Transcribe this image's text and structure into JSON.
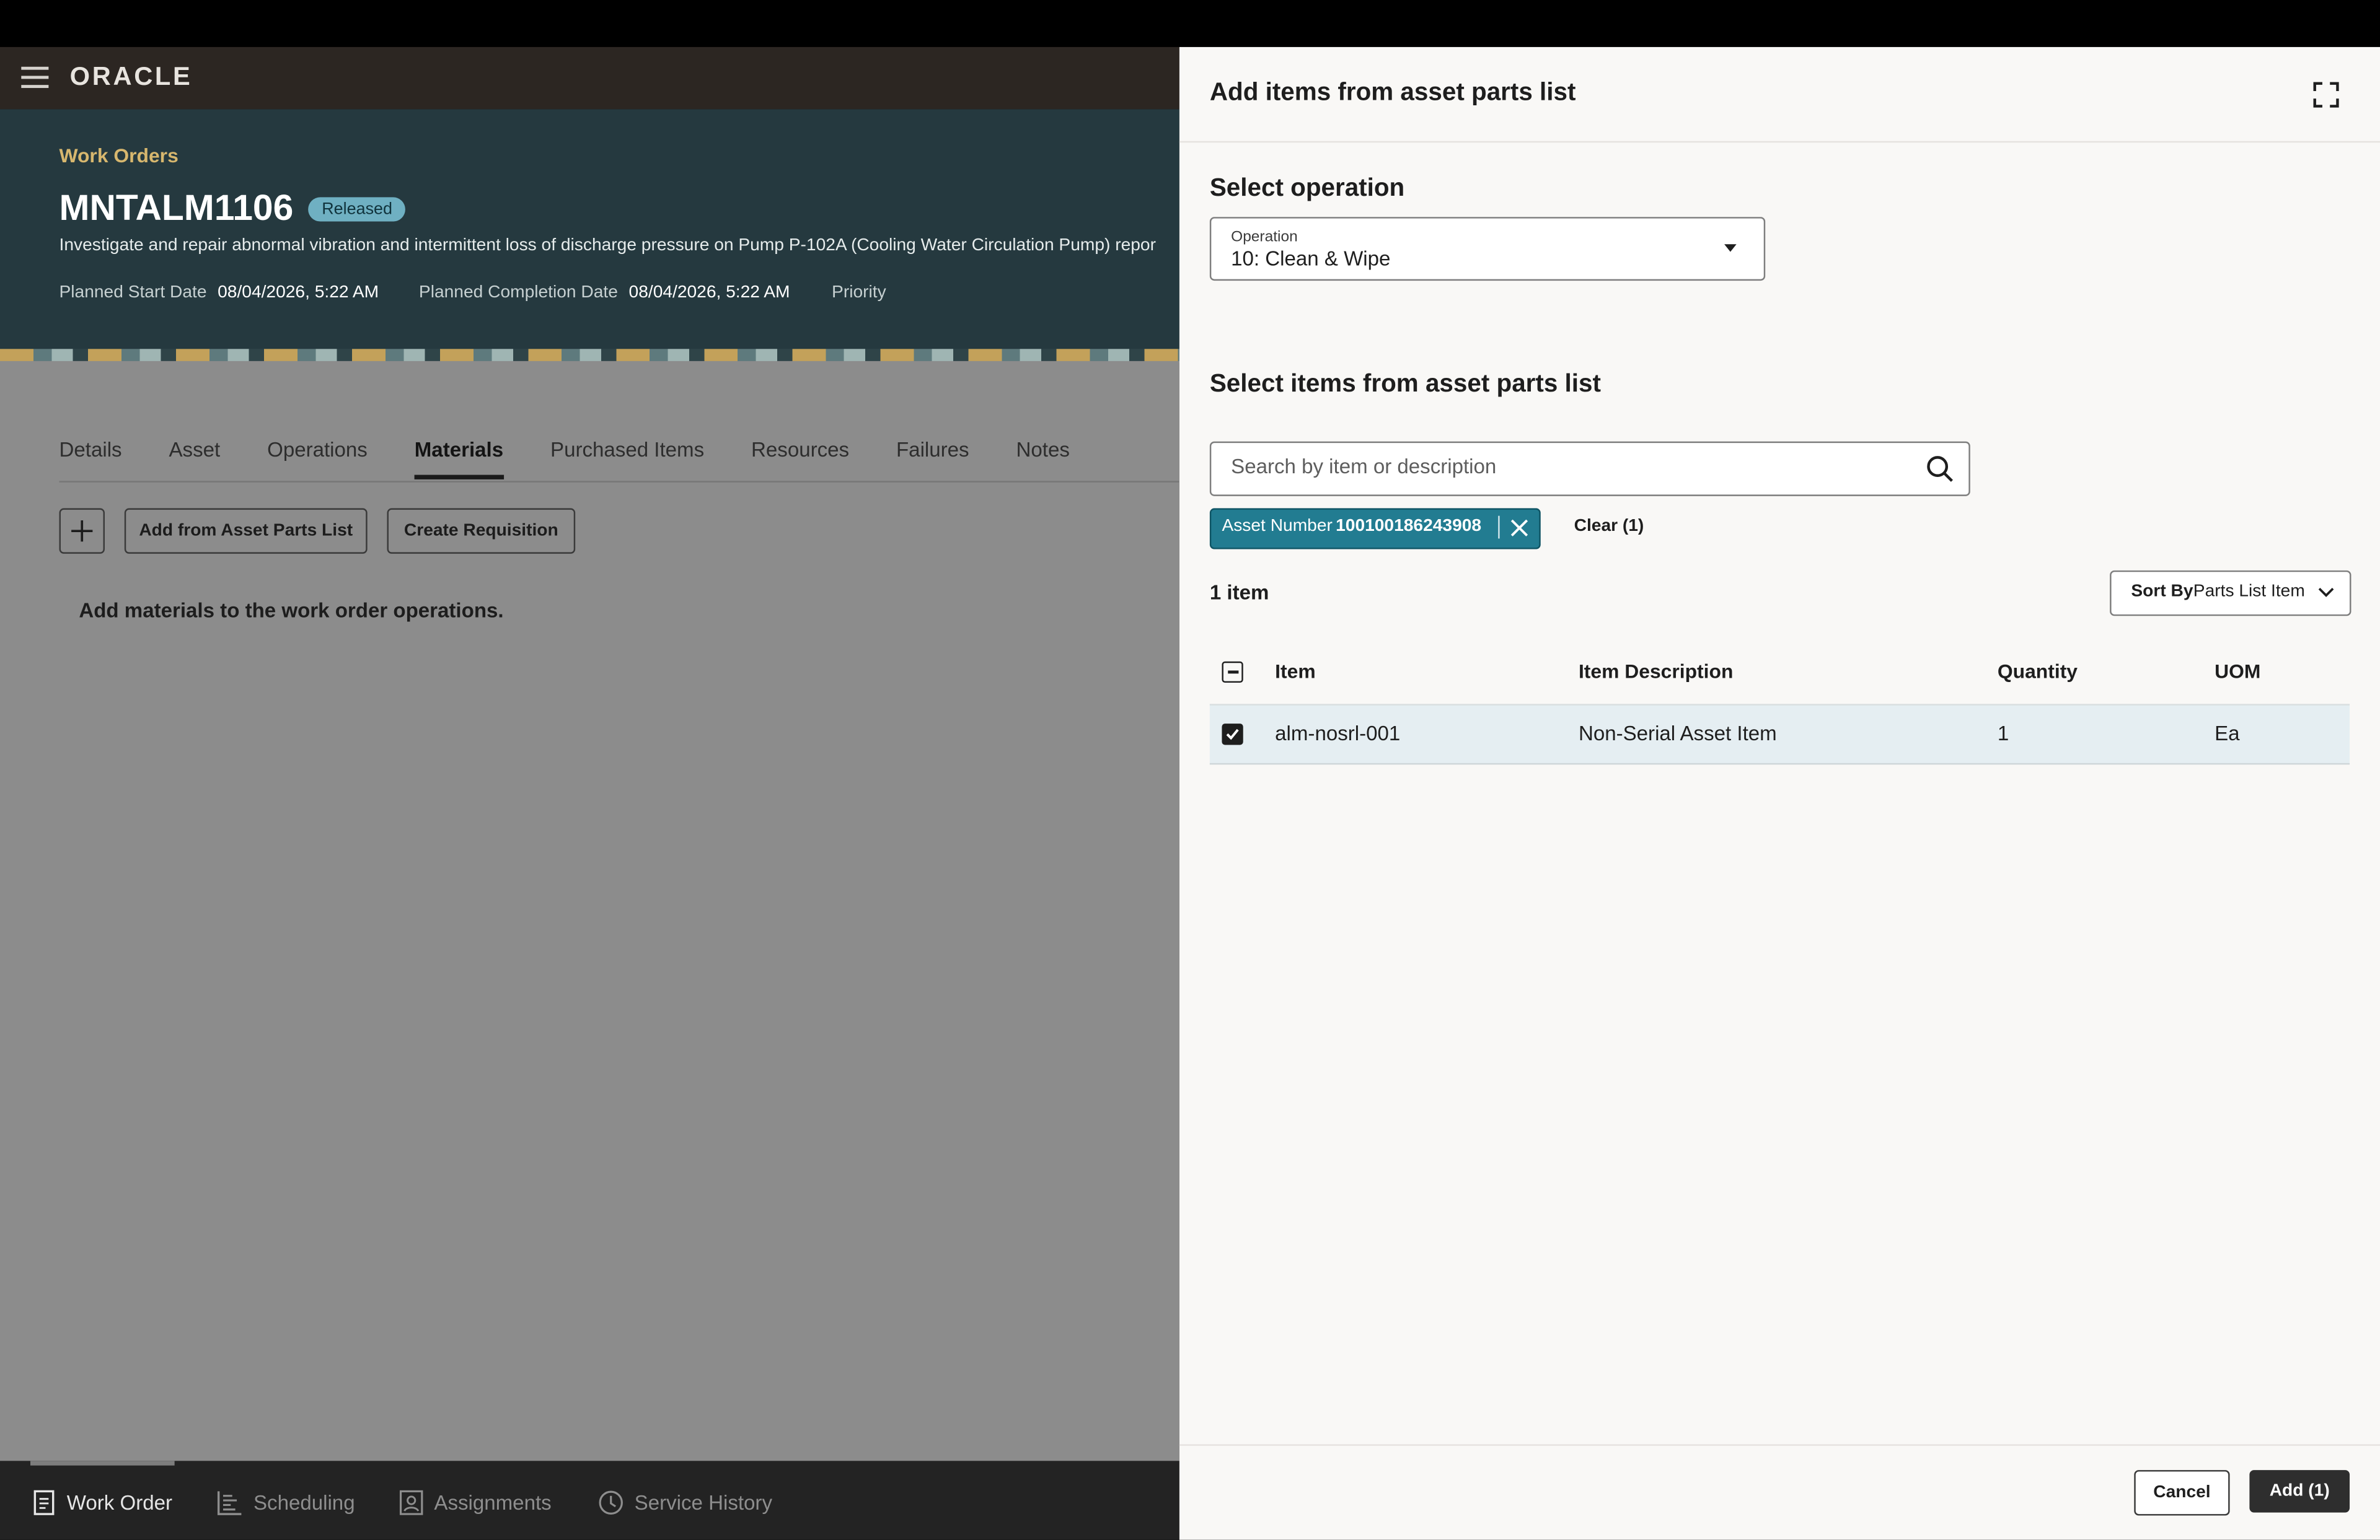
{
  "app": {
    "logo": "ORACLE"
  },
  "hero": {
    "breadcrumb": "Work Orders",
    "title": "MNTALM1106",
    "status": "Released",
    "description": "Investigate and repair abnormal vibration and intermittent loss of discharge pressure on Pump P-102A (Cooling Water Circulation Pump) repor",
    "planned_start_label": "Planned Start Date",
    "planned_start_value": "08/04/2026, 5:22 AM",
    "planned_completion_label": "Planned Completion Date",
    "planned_completion_value": "08/04/2026, 5:22 AM",
    "priority_label": "Priority"
  },
  "tabs": [
    "Details",
    "Asset",
    "Operations",
    "Materials",
    "Purchased Items",
    "Resources",
    "Failures",
    "Notes"
  ],
  "toolbar": {
    "add_from_parts": "Add from Asset Parts List",
    "create_requisition": "Create Requisition"
  },
  "empty_message": "Add materials to the work order operations.",
  "bottom_nav": {
    "work_order": "Work Order",
    "scheduling": "Scheduling",
    "assignments": "Assignments",
    "service_history": "Service History"
  },
  "drawer": {
    "title": "Add items from asset parts list",
    "select_operation_heading": "Select operation",
    "operation_label": "Operation",
    "operation_value": "10: Clean & Wipe",
    "select_items_heading": "Select items from asset parts list",
    "search_placeholder": "Search by item or description",
    "filter_chip_label": "Asset Number",
    "filter_chip_value": "100100186243908",
    "clear_label": "Clear (1)",
    "count": "1 item",
    "sort_prefix": "Sort By",
    "sort_value": "Parts List Item",
    "columns": {
      "item": "Item",
      "description": "Item Description",
      "quantity": "Quantity",
      "uom": "UOM"
    },
    "rows": [
      {
        "item": "alm-nosrl-001",
        "description": "Non-Serial Asset Item",
        "quantity": "1",
        "uom": "Ea"
      }
    ],
    "cancel": "Cancel",
    "add": "Add (1)"
  },
  "colors": {
    "accent_teal": "#227c91",
    "hero_bg": "#25393f",
    "crumb_gold": "#d7b76e"
  }
}
